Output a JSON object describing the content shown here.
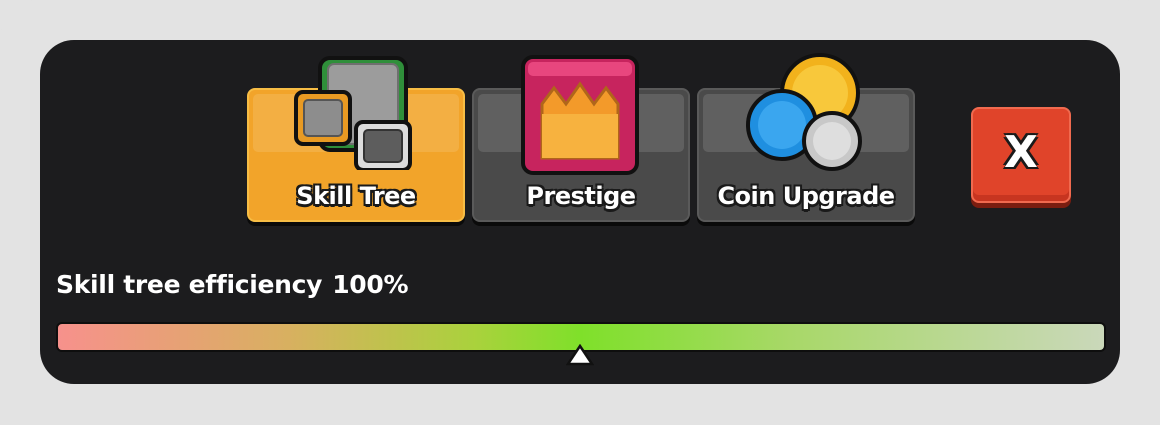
{
  "tabs": [
    {
      "label": "Skill Tree",
      "icon": "skill-tree-icon",
      "active": true
    },
    {
      "label": "Prestige",
      "icon": "crown-icon",
      "active": false
    },
    {
      "label": "Coin Upgrade",
      "icon": "coins-icon",
      "active": false
    }
  ],
  "close_button": {
    "label": "X",
    "color": "#e0442a"
  },
  "efficiency": {
    "label": "Skill tree efficiency",
    "value": "100%",
    "level": 1.0
  },
  "colors": {
    "active_tab": "#f2a42a",
    "inactive_tab": "#4a4a4a",
    "panel": "#1c1c1e"
  }
}
